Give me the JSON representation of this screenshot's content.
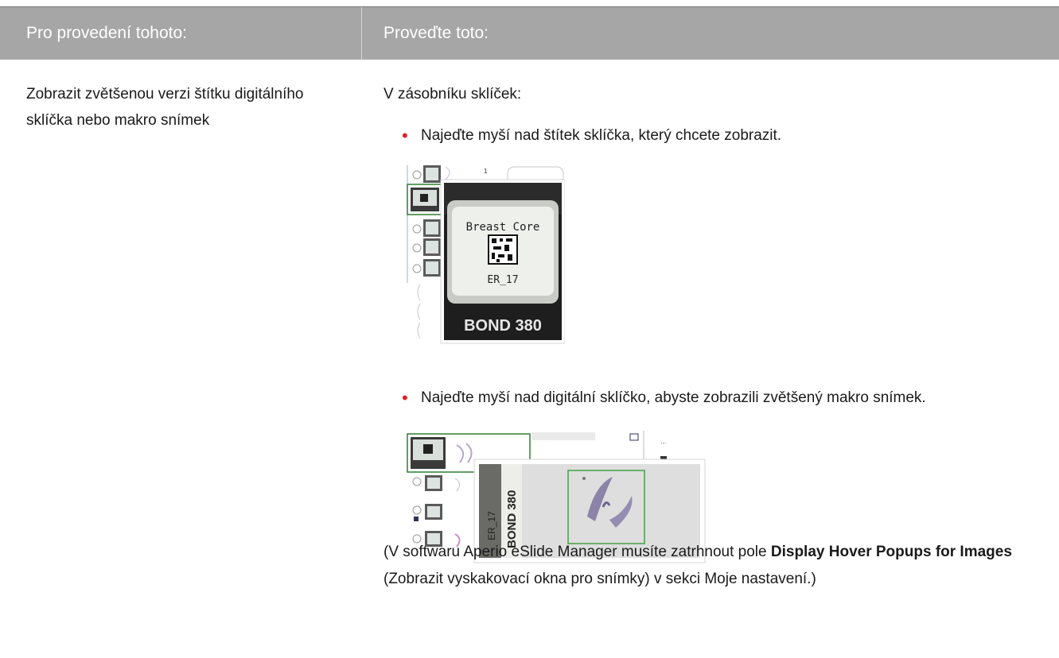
{
  "header": {
    "col1": "Pro provedení tohoto:",
    "col2": "Proveďte toto:"
  },
  "row": {
    "task": "Zobrazit zvětšenou verzi štítku digitálního sklíčka nebo makro snímek",
    "intro": "V zásobníku sklíček:",
    "bullets": [
      "Najeďte myší nad štítek sklíčka, který chcete zobrazit.",
      "Najeďte myší nad digitální sklíčko, abyste zobrazili zvětšený makro snímek."
    ],
    "note": {
      "pre": "(V softwaru Aperio eSlide Manager musíte zatrhnout pole ",
      "bold": "Display Hover Popups for Images",
      "post": " (Zobrazit vyskakovací okna pro snímky) v sekci Moje nastavení.)"
    }
  },
  "figure1": {
    "label_line1": "Breast  Core",
    "label_line2": "ER_17",
    "footer": "BOND 380",
    "small_number": "1"
  },
  "figure2": {
    "label_vertical_1": "BOND 380",
    "label_vertical_2": "ER_17"
  },
  "colors": {
    "header_bg": "#a6a6a6",
    "bullet": "#e1222a",
    "selection_green": "#2e7d32"
  }
}
